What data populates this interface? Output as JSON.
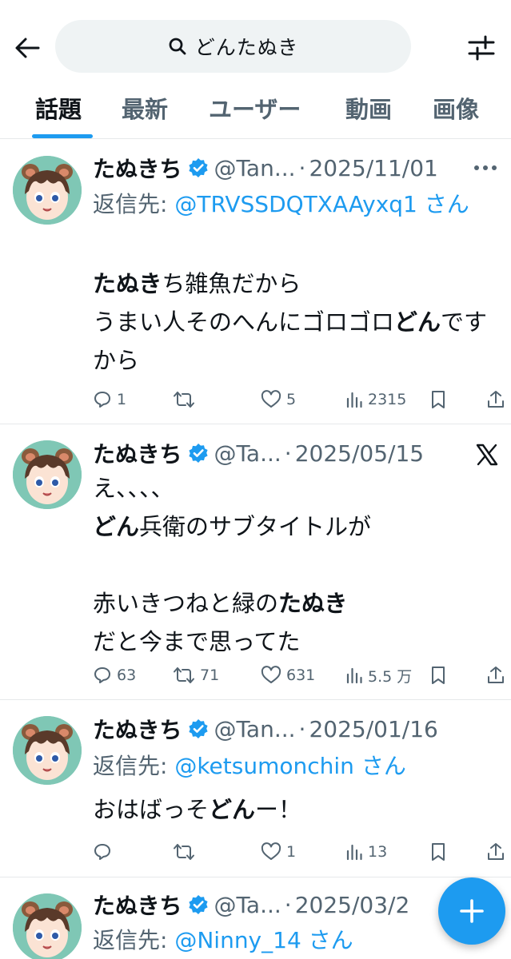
{
  "search": {
    "query": "どんたぬき"
  },
  "tabs": [
    {
      "label": "話題"
    },
    {
      "label": "最新"
    },
    {
      "label": "ユーザー"
    },
    {
      "label": "動画"
    },
    {
      "label": "画像"
    }
  ],
  "tweets": [
    {
      "name": "たぬきち",
      "handle": "@Tan...",
      "date": "2025/11/01",
      "reply_prefix": "返信先: ",
      "reply_target": "@TRVSSDQTXAAyxq1 さん",
      "body": [
        {
          "text": "たぬき",
          "bold": true
        },
        {
          "text": "ち雑魚だから\nうまい人そのへんにゴロゴロ"
        },
        {
          "text": "どん",
          "bold": true
        },
        {
          "text": "ですから"
        }
      ],
      "stats": {
        "replies": "1",
        "retweets": "",
        "likes": "5",
        "views": "2315"
      }
    },
    {
      "name": "たぬきち",
      "handle": "@Ta...",
      "date": "2025/05/15",
      "body": [
        {
          "text": "え、、、、\n"
        },
        {
          "text": "どん",
          "bold": true
        },
        {
          "text": "兵衛のサブタイトルが\n\n赤いきつねと緑の"
        },
        {
          "text": "たぬき",
          "bold": true
        },
        {
          "text": "\nだと今まで思ってた"
        }
      ],
      "stats": {
        "replies": "63",
        "retweets": "71",
        "likes": "631",
        "views": "5.5 万"
      }
    },
    {
      "name": "たぬきち",
      "handle": "@Tan...",
      "date": "2025/01/16",
      "reply_prefix": "返信先: ",
      "reply_target": "@ketsumonchin さん",
      "body": [
        {
          "text": "おはばっそ"
        },
        {
          "text": "どん",
          "bold": true
        },
        {
          "text": "ー！"
        }
      ],
      "stats": {
        "replies": "",
        "retweets": "",
        "likes": "1",
        "views": "13"
      }
    },
    {
      "name": "たぬきち",
      "handle": "@Ta...",
      "date": "2025/03/2",
      "reply_prefix": "返信先: ",
      "reply_target": "@Ninny_14 さん"
    }
  ],
  "colors": {
    "accent": "#1d9bf0",
    "secondary_text": "#536471",
    "primary_text": "#0f1419"
  }
}
